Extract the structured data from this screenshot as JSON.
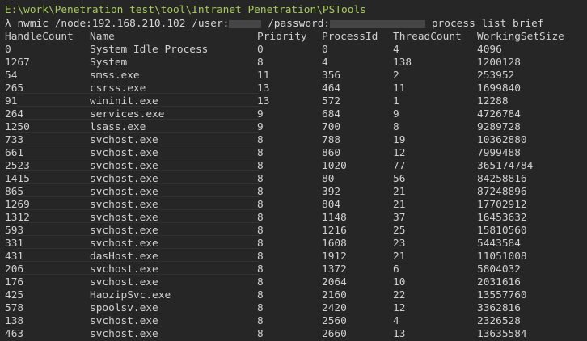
{
  "terminal": {
    "path": "E:\\work\\Penetration_test\\tool\\Intranet_Penetration\\PSTools",
    "prompt_symbol": "λ",
    "command_part1": "nwmic /node:192.168.210.102 /user:",
    "command_part2": " /password:",
    "command_part3": " process list brief"
  },
  "table": {
    "headers": [
      "HandleCount",
      "Name",
      "Priority",
      "ProcessId",
      "ThreadCount",
      "WorkingSetSize"
    ],
    "rows": [
      [
        "0",
        "System Idle Process",
        "0",
        "0",
        "4",
        "4096"
      ],
      [
        "1267",
        "System",
        "8",
        "4",
        "138",
        "1200128"
      ],
      [
        "54",
        "smss.exe",
        "11",
        "356",
        "2",
        "253952"
      ],
      [
        "265",
        "csrss.exe",
        "13",
        "464",
        "11",
        "1699840"
      ],
      [
        "91",
        "wininit.exe",
        "13",
        "572",
        "1",
        "12288"
      ],
      [
        "264",
        "services.exe",
        "9",
        "684",
        "9",
        "4726784"
      ],
      [
        "1250",
        "lsass.exe",
        "9",
        "700",
        "8",
        "9289728"
      ],
      [
        "733",
        "svchost.exe",
        "8",
        "788",
        "19",
        "10362880"
      ],
      [
        "661",
        "svchost.exe",
        "8",
        "860",
        "12",
        "7999488"
      ],
      [
        "2523",
        "svchost.exe",
        "8",
        "1020",
        "77",
        "365174784"
      ],
      [
        "1415",
        "svchost.exe",
        "8",
        "80",
        "56",
        "84258816"
      ],
      [
        "865",
        "svchost.exe",
        "8",
        "392",
        "21",
        "87248896"
      ],
      [
        "1269",
        "svchost.exe",
        "8",
        "804",
        "21",
        "17702912"
      ],
      [
        "1312",
        "svchost.exe",
        "8",
        "1148",
        "37",
        "16453632"
      ],
      [
        "593",
        "svchost.exe",
        "8",
        "1216",
        "25",
        "15810560"
      ],
      [
        "331",
        "svchost.exe",
        "8",
        "1608",
        "23",
        "5443584"
      ],
      [
        "431",
        "dasHost.exe",
        "8",
        "1912",
        "21",
        "11051008"
      ],
      [
        "206",
        "svchost.exe",
        "8",
        "1372",
        "6",
        "5804032"
      ],
      [
        "176",
        "svchost.exe",
        "8",
        "2064",
        "10",
        "2031616"
      ],
      [
        "425",
        "HaozipSvc.exe",
        "8",
        "2160",
        "22",
        "13557760"
      ],
      [
        "578",
        "spoolsv.exe",
        "8",
        "2420",
        "12",
        "3362816"
      ],
      [
        "138",
        "svchost.exe",
        "8",
        "2560",
        "4",
        "2326528"
      ],
      [
        "463",
        "svchost.exe",
        "8",
        "2660",
        "13",
        "13635584"
      ]
    ]
  },
  "colors": {
    "background": "#262626",
    "text": "#cfcfcf",
    "path": "#a6c95a"
  }
}
